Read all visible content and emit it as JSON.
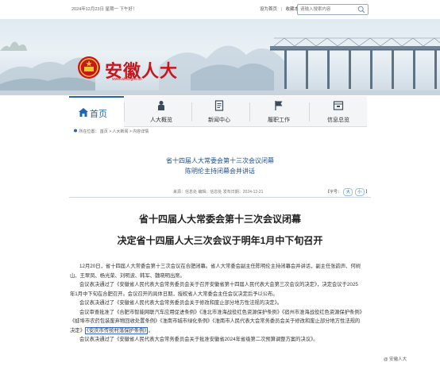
{
  "topbar": {
    "date": "2024年12月23日 星期一  下午好！",
    "links": [
      "设为首页",
      "|",
      "收藏本站"
    ],
    "search_placeholder": "请输入搜索内容"
  },
  "banner": {
    "site_name": "安徽人大",
    "site_url": "www.ahrd.gov.cn"
  },
  "nav": {
    "home": "首页",
    "items": [
      {
        "label": "人大概览",
        "icon": "person-flag-icon"
      },
      {
        "label": "新闻中心",
        "icon": "document-icon"
      },
      {
        "label": "履职工作",
        "icon": "flag-icon"
      },
      {
        "label": "信息总览",
        "icon": "folder-icon"
      }
    ]
  },
  "breadcrumb": {
    "prefix": "所在位置：",
    "items": [
      "首页",
      "人大新闻",
      "内容详情"
    ]
  },
  "article": {
    "sub_title_1": "省十四届人大常委会第十三次会议闭幕",
    "sub_title_2": "陈明伦主持闭幕会并讲话",
    "meta": "来源：信息处  编辑：信息处  发布日期：2024-12-21",
    "font_size_label": "【字号：",
    "font_size_large": "大",
    "font_size_small": "小",
    "font_size_end": "】",
    "headline_1": "省十四届人大常委会第十三次会议闭幕",
    "headline_2": "决定省十四届人大三次会议于明年1月中下旬召开",
    "paragraphs": [
      "12月20日，省十四届人大常委会第十三次会议在合肥闭幕。省人大常委会副主任陈明伦主持闭幕会并讲话，副主任张韵声、何树山、王翠凤、杨光荣、刘明波、韩军、魏晓明出席。",
      "会议表决通过了《安徽省人民代表大会常务委员会关于召开安徽省第十四届人民代表大会第三次会议的决定》，决定会议于2025年1月中下旬在合肥召开。会议召开的具体日期，授权省人大常委会主任会议决定后予以公布。",
      "会议表决通过了《安徽省人民代表大会常务委员会关于修改和废止部分地方性法规的决定》。"
    ],
    "para4_text": "会议审查批准了《合肥市智能网联汽车应用促进条例》《淮北市淮海战役红色资源保护条例》《宿州市淮海战役红色资源保护条例》《蚌埠市农药包装废弃物回收处置条例》《淮南市城市绿化条例》《淮南市人民代表大会常务委员会关于修改和废止部分地方性法规的决定》",
    "para4_highlight": "《安庆市传统村落保护条例》",
    "para4_end": "。",
    "para5": "会议表决通过了《安徽省人民代表大会常务委员会关于批准安徽省2024年省级第二次预算调整方案的决议》。"
  },
  "watermark": "@ 安徽人大",
  "colors": {
    "accent": "#1f66b3",
    "brand_red": "#c8161d",
    "title_blue": "#1d4f8f"
  }
}
